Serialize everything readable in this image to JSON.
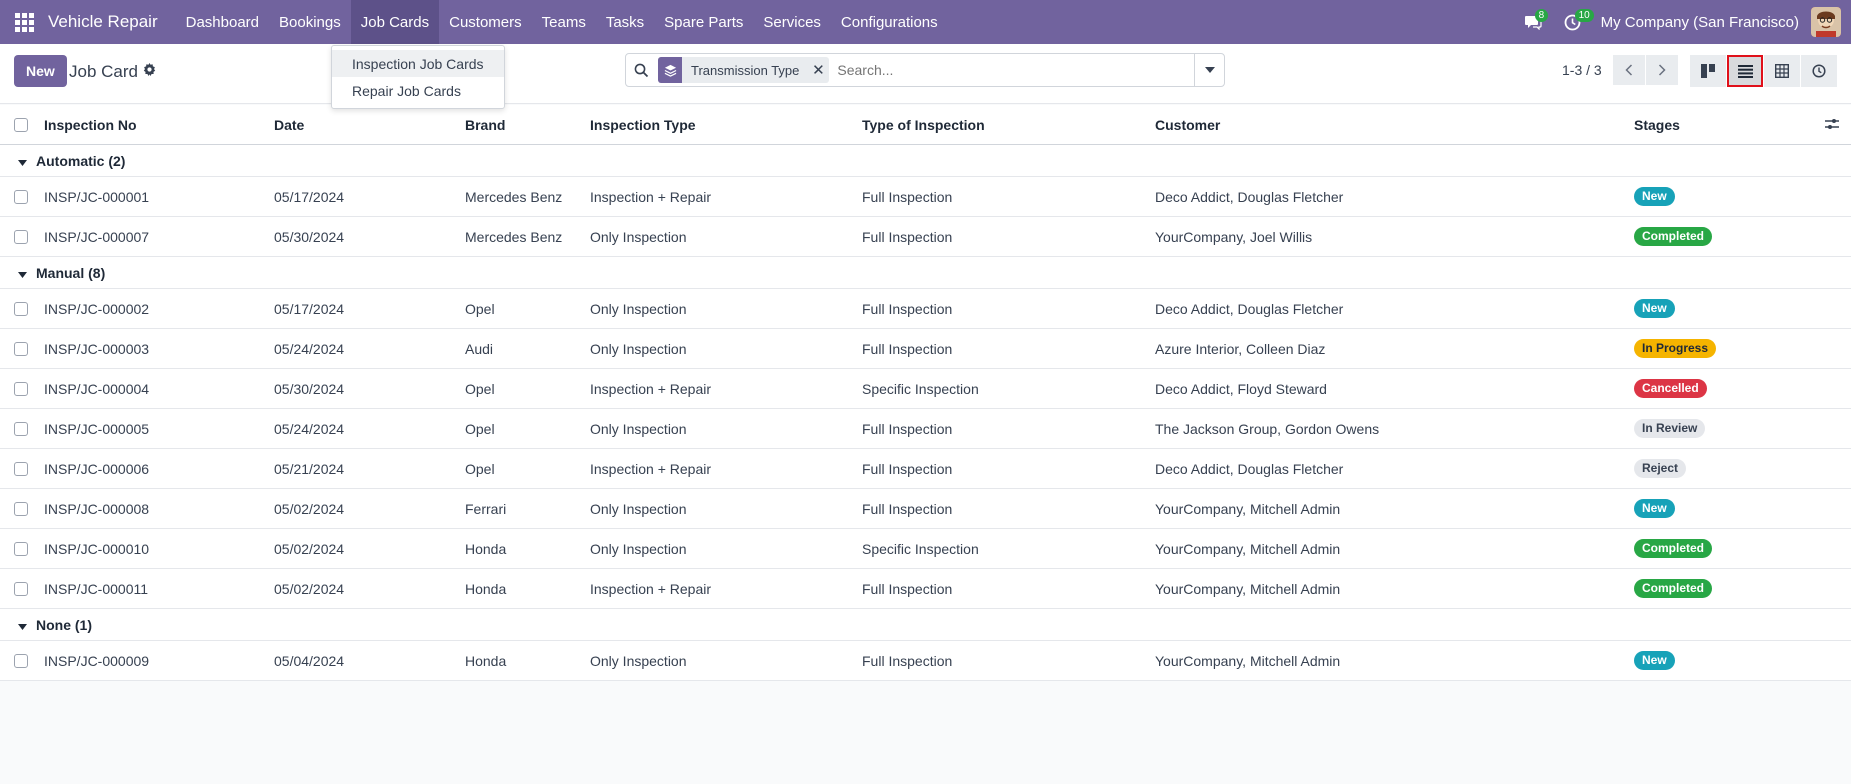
{
  "navbar": {
    "app_name": "Vehicle Repair",
    "menus": [
      "Dashboard",
      "Bookings",
      "Job Cards",
      "Customers",
      "Teams",
      "Tasks",
      "Spare Parts",
      "Services",
      "Configurations"
    ],
    "messages_count": "8",
    "activities_count": "10",
    "company": "My Company (San Francisco)"
  },
  "dropdown": {
    "items": [
      "Inspection Job Cards",
      "Repair Job Cards"
    ]
  },
  "control": {
    "new_label": "New",
    "title": "Job Card",
    "facet_label": "Transmission Type",
    "search_placeholder": "Search...",
    "pager": "1-3 / 3"
  },
  "columns": [
    "Inspection No",
    "Date",
    "Brand",
    "Inspection Type",
    "Type of Inspection",
    "Customer",
    "Stages"
  ],
  "groups": [
    {
      "label": "Automatic (2)",
      "rows": [
        [
          "INSP/JC-000001",
          "05/17/2024",
          "Mercedes Benz",
          "Inspection + Repair",
          "Full Inspection",
          "Deco Addict, Douglas Fletcher",
          "New"
        ],
        [
          "INSP/JC-000007",
          "05/30/2024",
          "Mercedes Benz",
          "Only Inspection",
          "Full Inspection",
          "YourCompany, Joel Willis",
          "Completed"
        ]
      ]
    },
    {
      "label": "Manual (8)",
      "rows": [
        [
          "INSP/JC-000002",
          "05/17/2024",
          "Opel",
          "Only Inspection",
          "Full Inspection",
          "Deco Addict, Douglas Fletcher",
          "New"
        ],
        [
          "INSP/JC-000003",
          "05/24/2024",
          "Audi",
          "Only Inspection",
          "Full Inspection",
          "Azure Interior, Colleen Diaz",
          "In Progress"
        ],
        [
          "INSP/JC-000004",
          "05/30/2024",
          "Opel",
          "Inspection + Repair",
          "Specific Inspection",
          "Deco Addict, Floyd Steward",
          "Cancelled"
        ],
        [
          "INSP/JC-000005",
          "05/24/2024",
          "Opel",
          "Only Inspection",
          "Full Inspection",
          "The Jackson Group, Gordon Owens",
          "In Review"
        ],
        [
          "INSP/JC-000006",
          "05/21/2024",
          "Opel",
          "Inspection + Repair",
          "Full Inspection",
          "Deco Addict, Douglas Fletcher",
          "Reject"
        ],
        [
          "INSP/JC-000008",
          "05/02/2024",
          "Ferrari",
          "Only Inspection",
          "Full Inspection",
          "YourCompany, Mitchell Admin",
          "New"
        ],
        [
          "INSP/JC-000010",
          "05/02/2024",
          "Honda",
          "Only Inspection",
          "Specific Inspection",
          "YourCompany, Mitchell Admin",
          "Completed"
        ],
        [
          "INSP/JC-000011",
          "05/02/2024",
          "Honda",
          "Inspection + Repair",
          "Full Inspection",
          "YourCompany, Mitchell Admin",
          "Completed"
        ]
      ]
    },
    {
      "label": "None (1)",
      "rows": [
        [
          "INSP/JC-000009",
          "05/04/2024",
          "Honda",
          "Only Inspection",
          "Full Inspection",
          "YourCompany, Mitchell Admin",
          "New"
        ]
      ]
    }
  ],
  "stage_colors": {
    "New": {
      "bg": "#17a2b8",
      "fg": "#ffffff"
    },
    "Completed": {
      "bg": "#28a745",
      "fg": "#ffffff"
    },
    "In Progress": {
      "bg": "#f5b400",
      "fg": "#1f2937"
    },
    "Cancelled": {
      "bg": "#dc3545",
      "fg": "#ffffff"
    },
    "In Review": {
      "bg": "#e5e7eb",
      "fg": "#374151"
    },
    "Reject": {
      "bg": "#e5e7eb",
      "fg": "#374151"
    }
  },
  "theme": {
    "brand": "#71639e",
    "highlight": "#e0101a"
  }
}
